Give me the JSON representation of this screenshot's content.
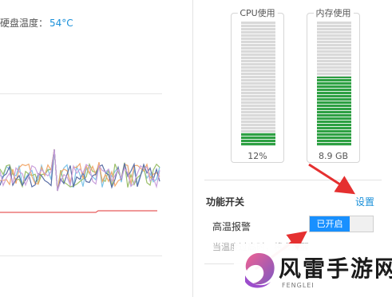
{
  "left_panel": {
    "disk_temp_label": "硬盘温度：",
    "disk_temp_value": "54°C",
    "chart_line_colors": [
      "#7ec4e8",
      "#9bbf6a",
      "#f2a86b",
      "#5b6fa6",
      "#c9a0dc"
    ],
    "threshold_color": "#e85c5c"
  },
  "meters": {
    "cpu": {
      "title": "CPU使用",
      "value": "12%",
      "fill_fraction": 0.11
    },
    "memory": {
      "title": "内存使用",
      "value": "8.9 GB",
      "fill_fraction": 0.56
    }
  },
  "features": {
    "section_title": "功能开关",
    "settings_link": "设置",
    "high_temp_alarm": {
      "label": "高温报警",
      "toggle_state": "已开启",
      "hint": "当温度过高时，将会提醒"
    }
  },
  "annotations": {
    "arrow_color": "#e53030"
  },
  "watermark": {
    "logo_text": "风雷手游网",
    "sub_text": "FENGLEI"
  },
  "colors": {
    "accent": "#1a90d9",
    "toggle_on": "#1890ff",
    "meter_green": "#2ea043"
  }
}
